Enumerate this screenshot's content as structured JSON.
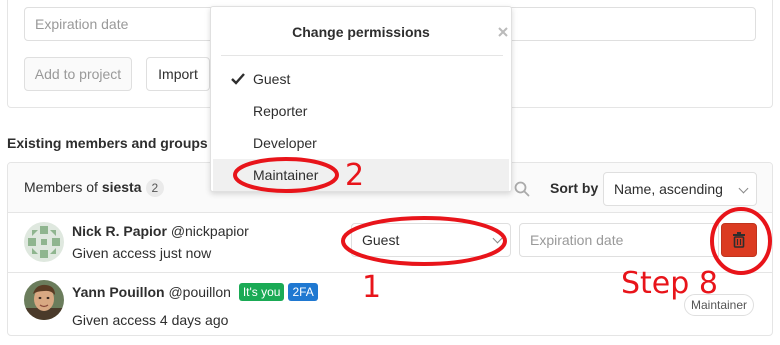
{
  "add_panel": {
    "expiration_placeholder": "Expiration date",
    "add_button": "Add to project",
    "import_button": "Import"
  },
  "section_heading": "Existing members and groups",
  "members_header": {
    "prefix": "Members of ",
    "project": "siesta",
    "count": "2",
    "sort_label": "Sort by",
    "sort_value": "Name, ascending",
    "search_icon": "search-icon"
  },
  "members": [
    {
      "name": "Nick R. Papior",
      "handle": "@nickpapior",
      "subtitle": "Given access just now",
      "role": "Guest",
      "expiration_placeholder": "Expiration date",
      "delete_icon": "trash-icon"
    },
    {
      "name": "Yann Pouillon",
      "handle": "@pouillon",
      "tags": [
        "It's you",
        "2FA"
      ],
      "subtitle": "Given access 4 days ago",
      "role_badge": "Maintainer"
    }
  ],
  "dropdown": {
    "title": "Change permissions",
    "close_icon": "close-icon",
    "options": [
      "Guest",
      "Reporter",
      "Developer",
      "Maintainer"
    ],
    "selected": "Guest",
    "highlighted": "Maintainer"
  },
  "annotations": {
    "label_1": "1",
    "label_2": "2",
    "step_label": "Step 8",
    "color": "#e8141a"
  },
  "colors": {
    "danger": "#db3b21",
    "success": "#1aaa55",
    "info": "#1f78d1"
  }
}
